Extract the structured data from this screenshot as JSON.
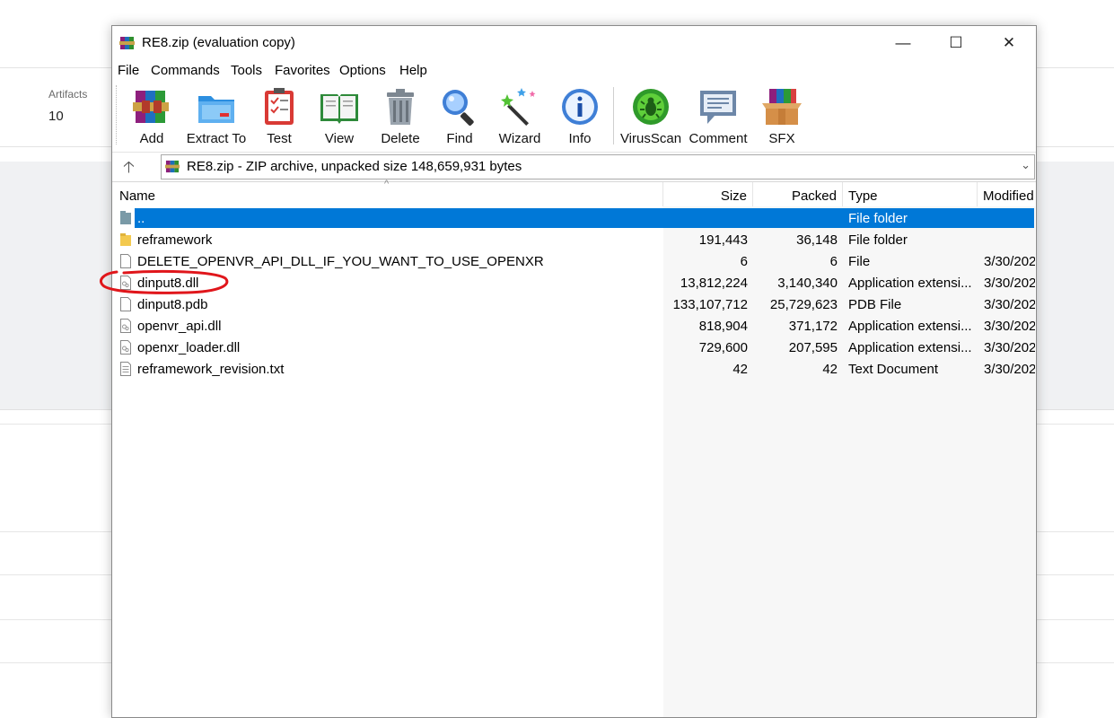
{
  "background": {
    "artifacts_label": "Artifacts",
    "artifacts_value": "10"
  },
  "window": {
    "title": "RE8.zip (evaluation copy)",
    "controls": {
      "minimize": "—",
      "maximize": "☐",
      "close": "✕"
    }
  },
  "menu": [
    "File",
    "Commands",
    "Tools",
    "Favorites",
    "Options",
    "Help"
  ],
  "toolbar": [
    {
      "label": "Add",
      "icon": "winrar-books-icon"
    },
    {
      "label": "Extract To",
      "icon": "folder-extract-icon"
    },
    {
      "label": "Test",
      "icon": "clipboard-check-icon"
    },
    {
      "label": "View",
      "icon": "open-book-icon"
    },
    {
      "label": "Delete",
      "icon": "trash-can-icon"
    },
    {
      "label": "Find",
      "icon": "magnifier-icon"
    },
    {
      "label": "Wizard",
      "icon": "magic-wand-icon"
    },
    {
      "label": "Info",
      "icon": "info-icon"
    },
    {
      "label": "VirusScan",
      "icon": "bug-scan-icon"
    },
    {
      "label": "Comment",
      "icon": "speech-bubble-icon"
    },
    {
      "label": "SFX",
      "icon": "box-books-icon"
    }
  ],
  "address": {
    "text": "RE8.zip - ZIP archive, unpacked size 148,659,931 bytes",
    "up_arrow": "🡡",
    "dropdown": "⌄"
  },
  "columns": {
    "name": "Name",
    "size": "Size",
    "packed": "Packed",
    "type": "Type",
    "modified": "Modified",
    "sort_caret": "^"
  },
  "files": [
    {
      "name": "..",
      "size": "",
      "packed": "",
      "type": "File folder",
      "modified": "",
      "icon": "parent-folder-icon",
      "selected": true
    },
    {
      "name": "reframework",
      "size": "191,443",
      "packed": "36,148",
      "type": "File folder",
      "modified": "",
      "icon": "folder-icon"
    },
    {
      "name": "DELETE_OPENVR_API_DLL_IF_YOU_WANT_TO_USE_OPENXR",
      "size": "6",
      "packed": "6",
      "type": "File",
      "modified": "3/30/202",
      "icon": "file-icon"
    },
    {
      "name": "dinput8.dll",
      "size": "13,812,224",
      "packed": "3,140,340",
      "type": "Application extensi...",
      "modified": "3/30/202",
      "icon": "dll-file-icon"
    },
    {
      "name": "dinput8.pdb",
      "size": "133,107,712",
      "packed": "25,729,623",
      "type": "PDB File",
      "modified": "3/30/202",
      "icon": "file-icon"
    },
    {
      "name": "openvr_api.dll",
      "size": "818,904",
      "packed": "371,172",
      "type": "Application extensi...",
      "modified": "3/30/202",
      "icon": "dll-file-icon"
    },
    {
      "name": "openxr_loader.dll",
      "size": "729,600",
      "packed": "207,595",
      "type": "Application extensi...",
      "modified": "3/30/202",
      "icon": "dll-file-icon"
    },
    {
      "name": "reframework_revision.txt",
      "size": "42",
      "packed": "42",
      "type": "Text Document",
      "modified": "3/30/202",
      "icon": "text-file-icon"
    }
  ],
  "colors": {
    "selection": "#0078d7",
    "annotation": "#e0161b"
  }
}
